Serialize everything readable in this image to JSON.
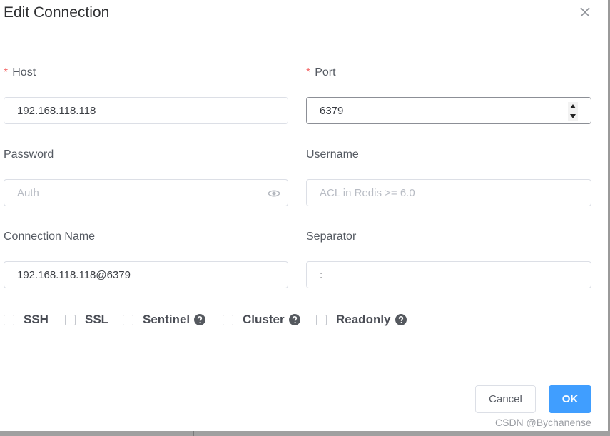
{
  "dialog": {
    "title": "Edit Connection",
    "close_icon": "close-icon"
  },
  "fields": {
    "host": {
      "label": "Host",
      "required": "*",
      "value": "192.168.118.118",
      "placeholder": ""
    },
    "port": {
      "label": "Port",
      "required": "*",
      "value": "6379",
      "placeholder": ""
    },
    "password": {
      "label": "Password",
      "value": "",
      "placeholder": "Auth",
      "icon": "eye-icon"
    },
    "username": {
      "label": "Username",
      "value": "",
      "placeholder": "ACL in Redis >= 6.0"
    },
    "connection_name": {
      "label": "Connection Name",
      "value": "192.168.118.118@6379",
      "placeholder": ""
    },
    "separator": {
      "label": "Separator",
      "value": ":",
      "placeholder": ""
    }
  },
  "options": [
    {
      "label": "SSH",
      "checked": false,
      "help": false
    },
    {
      "label": "SSL",
      "checked": false,
      "help": false
    },
    {
      "label": "Sentinel",
      "checked": false,
      "help": true
    },
    {
      "label": "Cluster",
      "checked": false,
      "help": true
    },
    {
      "label": "Readonly",
      "checked": false,
      "help": true
    }
  ],
  "footer": {
    "cancel_label": "Cancel",
    "ok_label": "OK"
  },
  "watermark": "CSDN @Bychanense",
  "colors": {
    "primary": "#409eff",
    "required": "#f56c6c",
    "border": "#dcdfe6"
  }
}
